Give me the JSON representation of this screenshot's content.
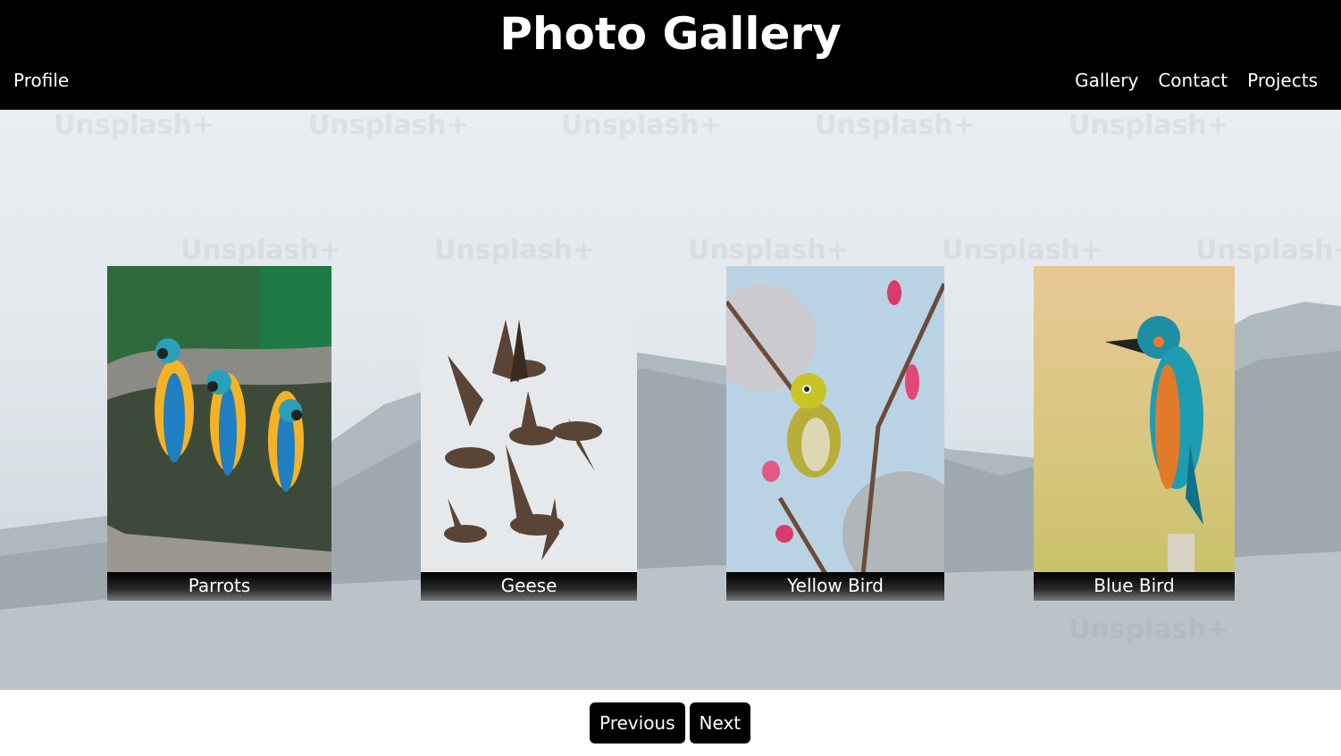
{
  "header": {
    "title": "Photo Gallery",
    "nav_left": "Profile",
    "nav_right": [
      "Gallery",
      "Contact",
      "Projects"
    ]
  },
  "hero": {
    "watermark_text": "Unsplash+"
  },
  "gallery": {
    "cards": [
      {
        "caption": "Parrots",
        "image": "parrots-photo"
      },
      {
        "caption": "Geese",
        "image": "geese-photo"
      },
      {
        "caption": "Yellow Bird",
        "image": "yellow-bird-photo"
      },
      {
        "caption": "Blue Bird",
        "image": "blue-bird-photo"
      }
    ]
  },
  "pagination": {
    "previous_label": "Previous",
    "next_label": "Next"
  },
  "colors": {
    "header_bg": "#000000",
    "button_bg": "#000000",
    "text_light": "#ffffff"
  }
}
